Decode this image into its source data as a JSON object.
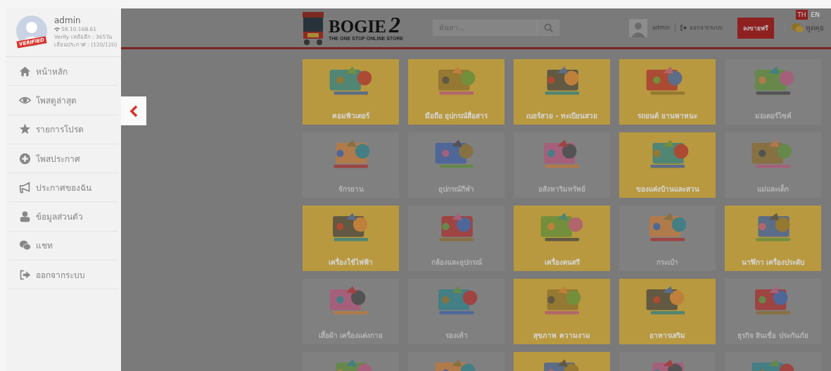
{
  "sidebar": {
    "profile": {
      "name": "admin",
      "badge": "VERIFIED",
      "ip": "58.10.168.61",
      "verify": "Verify เหลืออีก : 365วัน",
      "bumps": "เลื่อนประกาศ : (120/120)"
    },
    "items": [
      {
        "label": "หน้าหลัก",
        "kind": "home"
      },
      {
        "label": "โพสดูล่าสุด",
        "kind": "eye"
      },
      {
        "label": "รายการโปรด",
        "kind": "star"
      },
      {
        "label": "โพสประกาศ",
        "kind": "plus"
      },
      {
        "label": "ประกาศของฉัน",
        "kind": "megaphone"
      },
      {
        "label": "ข้อมูลส่วนตัว",
        "kind": "user"
      },
      {
        "label": "แชท",
        "kind": "chat"
      },
      {
        "label": "ออกจากระบบ",
        "kind": "logout"
      }
    ]
  },
  "header": {
    "logo": "BOGIE",
    "logo_mark": "2",
    "tagline": "THE ONE STOP ONLINE STORE",
    "search": {
      "placeholder": "ค้นหา..."
    },
    "languages": [
      {
        "label": "TH",
        "selected": true
      },
      {
        "label": "EN",
        "selected": false
      }
    ],
    "user": "admin",
    "logout": "ออกจากระบบ",
    "sell_button": "ลงขายฟรี",
    "chat": "พูดคุย"
  },
  "categories": [
    {
      "label": "คอมพิวเตอร์",
      "highlight": true
    },
    {
      "label": "มือถือ อุปกรณ์สื่อสาร",
      "highlight": true
    },
    {
      "label": "เบอร์สวย - ทะเบียนสวย",
      "highlight": true
    },
    {
      "label": "รถยนต์ ยานพาหนะ",
      "highlight": true
    },
    {
      "label": "มอเตอร์ไซค์",
      "highlight": false
    },
    {
      "label": "จักรยาน",
      "highlight": false
    },
    {
      "label": "อุปกรณ์กีฬา",
      "highlight": false
    },
    {
      "label": "อสังหาริมทรัพย์",
      "highlight": false
    },
    {
      "label": "ของแต่งบ้านและสวน",
      "highlight": true
    },
    {
      "label": "แม่และเด็ก",
      "highlight": false
    },
    {
      "label": "เครื่องใช้ไฟฟ้า",
      "highlight": true
    },
    {
      "label": "กล้องและอุปกรณ์",
      "highlight": false
    },
    {
      "label": "เครื่องดนตรี",
      "highlight": true
    },
    {
      "label": "กระเป๋า",
      "highlight": false
    },
    {
      "label": "นาฬิกา เครื่องประดับ",
      "highlight": true
    },
    {
      "label": "เสื้อผ้า เครื่องแต่งกาย",
      "highlight": false
    },
    {
      "label": "รองเท้า",
      "highlight": false
    },
    {
      "label": "สุขภาพ ความงาม",
      "highlight": true
    },
    {
      "label": "อาหารเสริม",
      "highlight": true
    },
    {
      "label": "ธุรกิจ สินเชื่อ ประกันภัย",
      "highlight": false
    },
    {
      "highlight": false
    },
    {
      "highlight": false
    },
    {
      "highlight": true
    },
    {
      "highlight": false
    },
    {
      "highlight": false
    }
  ]
}
